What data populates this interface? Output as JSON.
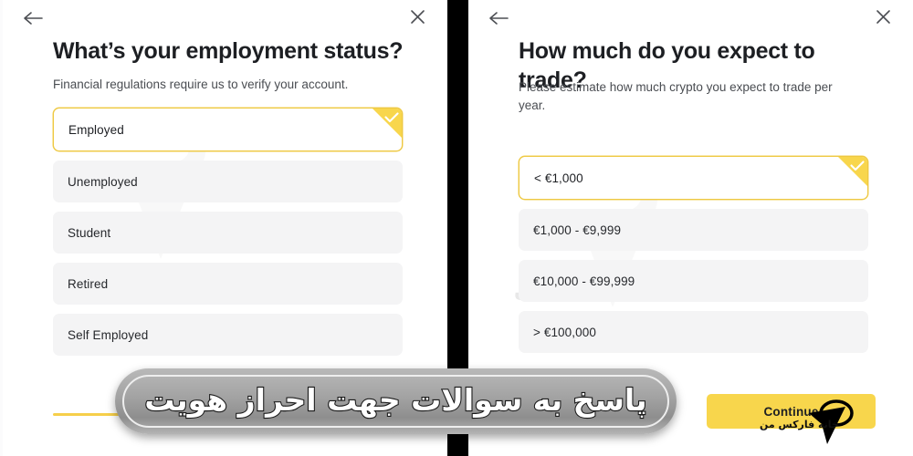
{
  "left_panel": {
    "back_icon": "arrow-left-icon",
    "close_icon": "close-icon",
    "title": "What’s your employment status?",
    "subtitle": "Financial regulations require us to verify your account.",
    "options": [
      {
        "label": "Employed",
        "selected": true
      },
      {
        "label": "Unemployed",
        "selected": false
      },
      {
        "label": "Student",
        "selected": false
      },
      {
        "label": "Retired",
        "selected": false
      },
      {
        "label": "Self Employed",
        "selected": false
      }
    ],
    "watermark_text": "خانه فارکس من"
  },
  "right_panel": {
    "back_icon": "arrow-left-icon",
    "close_icon": "close-icon",
    "title": "How much do you expect to trade?",
    "subtitle": "Please estimate how much crypto you expect to trade per year.",
    "options": [
      {
        "label": "< €1,000",
        "selected": true
      },
      {
        "label": "€1,000 - €9,999",
        "selected": false
      },
      {
        "label": "€10,000 - €99,999",
        "selected": false
      },
      {
        "label": "> €100,000",
        "selected": false
      }
    ],
    "continue_label": "Continue",
    "watermark_text": "خانه فارکس من"
  },
  "overlay": {
    "banner_text": "پاسخ به سوالات جهت احراز هویت",
    "cursor_watermark": "خانه فارکس من"
  },
  "colors": {
    "accent_yellow": "#f8d64c",
    "selected_border": "#eec842",
    "option_bg": "#f4f4f5",
    "text_dark": "#1d1f23",
    "text_muted": "#4a4d52",
    "divider_black": "#000000"
  }
}
